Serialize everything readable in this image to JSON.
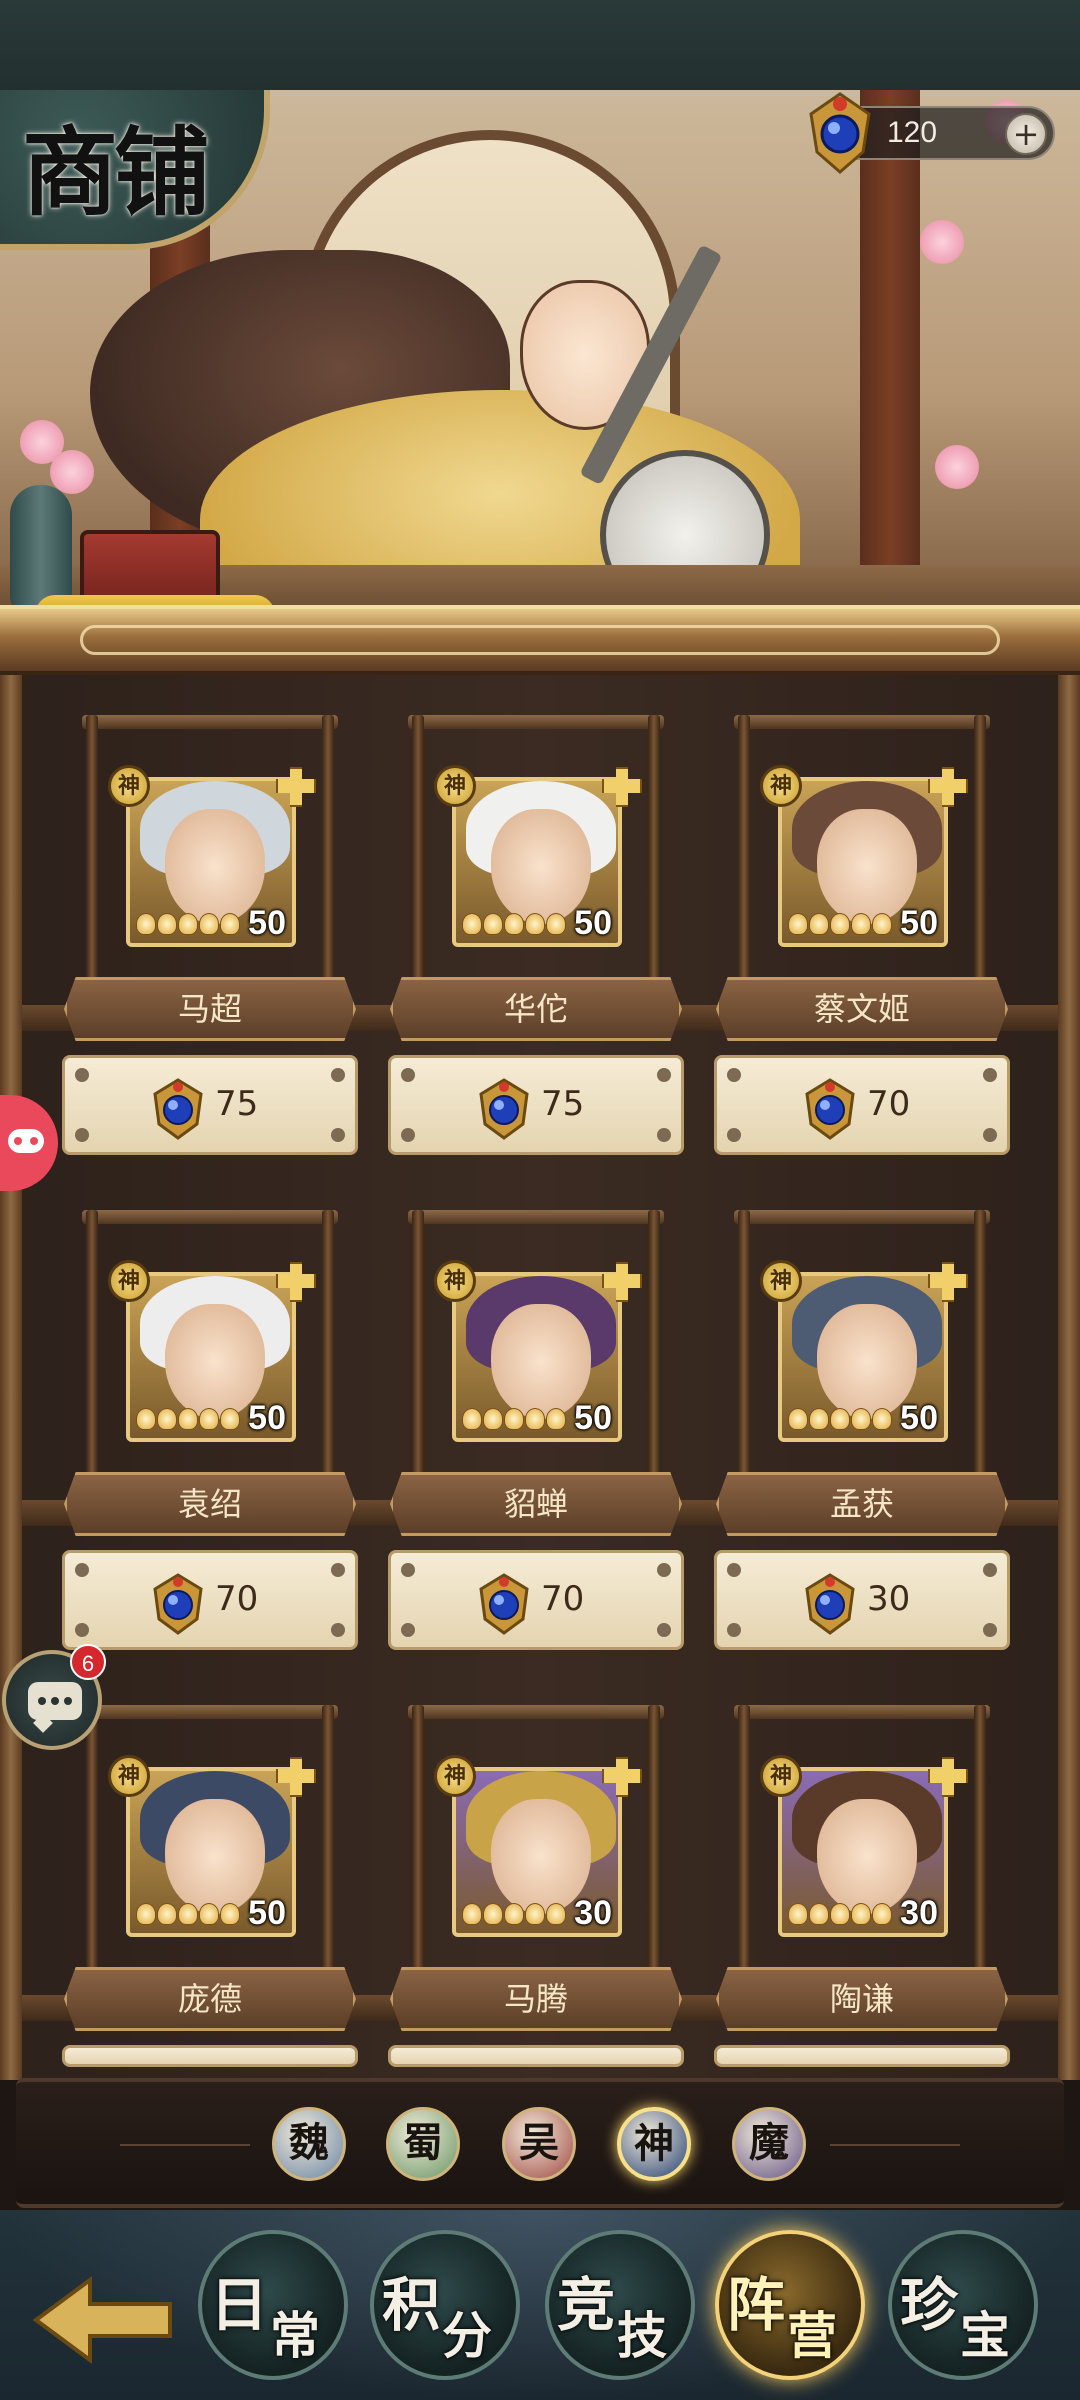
{
  "header": {
    "title": "商铺"
  },
  "currency": {
    "amount": "120",
    "plus_label": "+",
    "icon": "blue-gem-icon"
  },
  "items": [
    {
      "name": "马超",
      "level": "50",
      "price": "75",
      "faction": "神",
      "portrait_colors": {
        "bg": "#c9a356",
        "hair": "#cfd6dc"
      }
    },
    {
      "name": "华佗",
      "level": "50",
      "price": "75",
      "faction": "神",
      "portrait_colors": {
        "bg": "#c9a356",
        "hair": "#f0f0ee"
      }
    },
    {
      "name": "蔡文姬",
      "level": "50",
      "price": "70",
      "faction": "神",
      "portrait_colors": {
        "bg": "#c9a356",
        "hair": "#6b4a3a"
      }
    },
    {
      "name": "袁绍",
      "level": "50",
      "price": "70",
      "faction": "神",
      "portrait_colors": {
        "bg": "#c9a356",
        "hair": "#ededed"
      }
    },
    {
      "name": "貂蝉",
      "level": "50",
      "price": "70",
      "faction": "神",
      "portrait_colors": {
        "bg": "#c9a356",
        "hair": "#5a3a6a"
      }
    },
    {
      "name": "孟获",
      "level": "50",
      "price": "30",
      "faction": "神",
      "portrait_colors": {
        "bg": "#c9a356",
        "hair": "#4d5b73"
      }
    },
    {
      "name": "庞德",
      "level": "50",
      "price": "",
      "faction": "神",
      "portrait_colors": {
        "bg": "#c9a356",
        "hair": "#3d4a66"
      }
    },
    {
      "name": "马腾",
      "level": "30",
      "price": "",
      "faction": "神",
      "portrait_colors": {
        "bg": "#8a6bb5",
        "hair": "#c9a347"
      }
    },
    {
      "name": "陶谦",
      "level": "30",
      "price": "",
      "faction": "神",
      "portrait_colors": {
        "bg": "#8a6bb5",
        "hair": "#5a3a28"
      }
    }
  ],
  "faction_filters": [
    {
      "label": "魏",
      "color": "#6f8aa8",
      "active": false
    },
    {
      "label": "蜀",
      "color": "#6f9a6a",
      "active": false
    },
    {
      "label": "吴",
      "color": "#a4504a",
      "active": false
    },
    {
      "label": "神",
      "color": "#2f4a7a",
      "active": true
    },
    {
      "label": "魔",
      "color": "#6a5a8a",
      "active": false
    }
  ],
  "tabs": [
    {
      "a": "日",
      "b": "常",
      "active": false
    },
    {
      "a": "积",
      "b": "分",
      "active": false
    },
    {
      "a": "竞",
      "b": "技",
      "active": false
    },
    {
      "a": "阵",
      "b": "营",
      "active": true
    },
    {
      "a": "珍",
      "b": "宝",
      "active": false
    }
  ],
  "chat": {
    "badge": "6"
  }
}
